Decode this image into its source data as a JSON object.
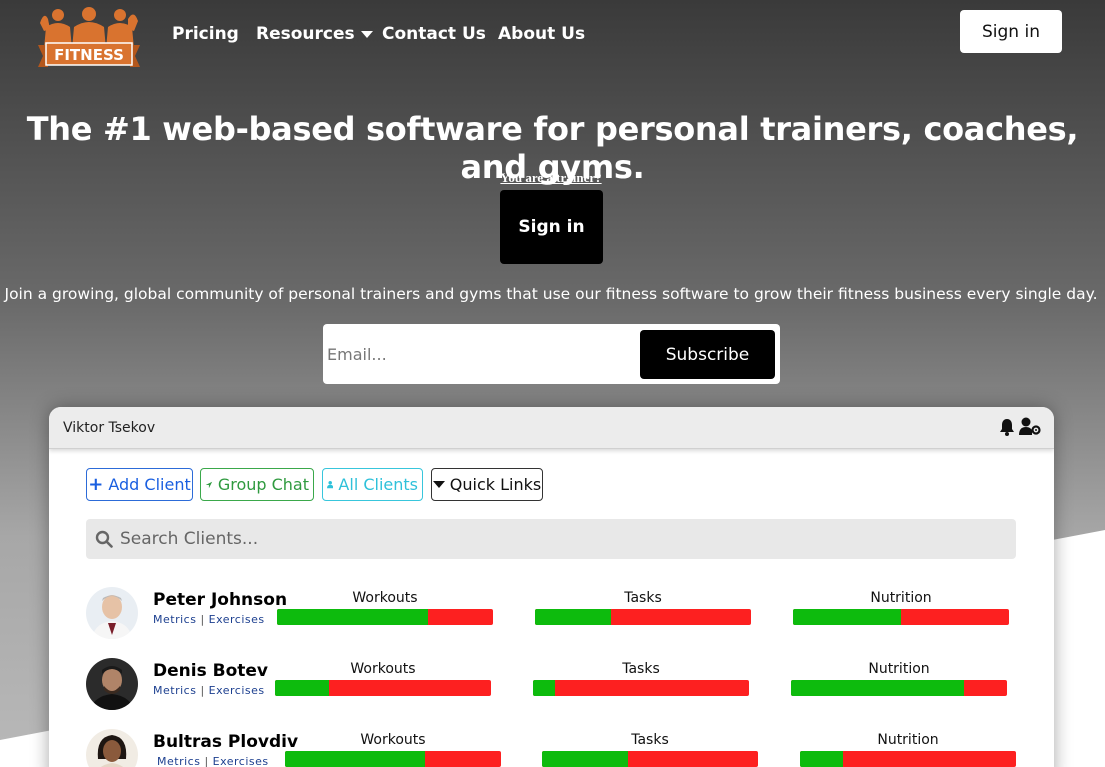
{
  "brand": {
    "logo_text": "FITNESS"
  },
  "nav": {
    "links": [
      "Pricing",
      "Resources",
      "Contact Us",
      "About Us"
    ],
    "signin": "Sign in"
  },
  "hero": {
    "title": "The #1 web-based software for personal trainers, coaches, and gyms.",
    "trainer_question": "You are a trainer?",
    "signin": "Sign in",
    "tagline": "Join a growing, global community of personal trainers and gyms that use our fitness software to grow their fitness business every single day.",
    "email_placeholder": "Email...",
    "subscribe": "Subscribe"
  },
  "app": {
    "user": "Viktor Tsekov",
    "toolbar": {
      "add_client": "Add Client",
      "group_chat": "Group Chat",
      "all_clients": "All Clients",
      "quick_links": "Quick Links"
    },
    "search_placeholder": "Search Clients...",
    "metric_labels": [
      "Workouts",
      "Tasks",
      "Nutrition"
    ],
    "link_labels": {
      "metrics": "Metrics",
      "exercises": "Exercises",
      "separator": "|"
    },
    "clients": [
      {
        "name": "Peter Johnson",
        "progress": {
          "workouts": 0.7,
          "tasks": 0.35,
          "nutrition": 0.5
        }
      },
      {
        "name": "Denis Botev",
        "progress": {
          "workouts": 0.25,
          "tasks": 0.1,
          "nutrition": 0.8
        }
      },
      {
        "name": "Bultras Plovdiv",
        "progress": {
          "workouts": 0.65,
          "tasks": 0.4,
          "nutrition": 0.2
        }
      }
    ]
  },
  "colors": {
    "accent_orange": "#d9732f",
    "progress_done": "#0dbb0d",
    "progress_remaining": "#fd2020",
    "add_client": "#1a5fe0",
    "group_chat": "#2f9a3f",
    "all_clients": "#2fc1da"
  },
  "icons": [
    "bell-icon",
    "user-gear-icon",
    "plus-icon",
    "location-arrow-icon",
    "user-icon",
    "caret-down-icon",
    "search-icon"
  ]
}
